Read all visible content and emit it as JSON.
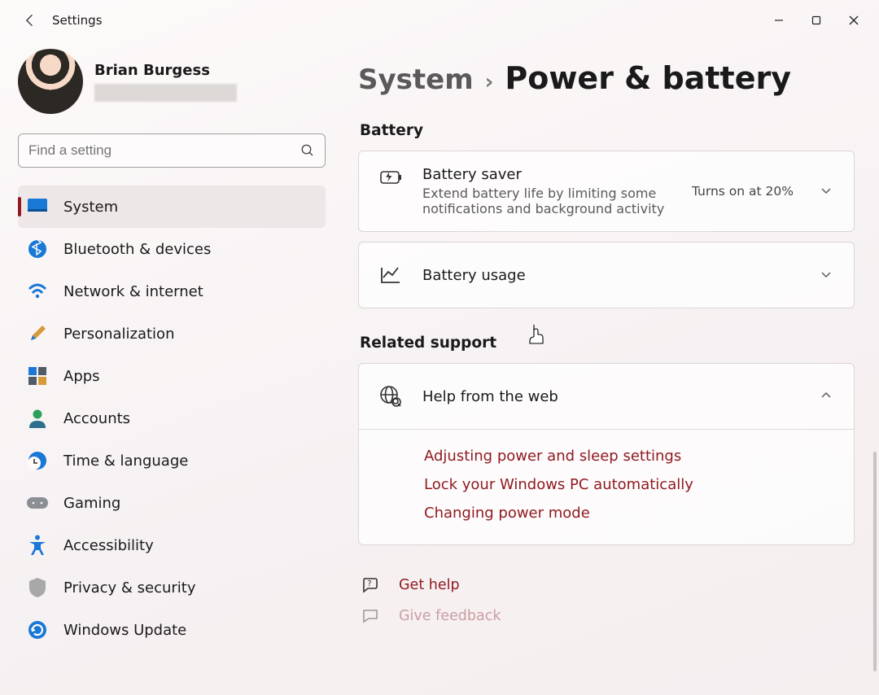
{
  "app": {
    "title": "Settings"
  },
  "user": {
    "name": "Brian Burgess"
  },
  "search": {
    "placeholder": "Find a setting"
  },
  "nav": {
    "items": [
      {
        "label": "System",
        "active": true
      },
      {
        "label": "Bluetooth & devices"
      },
      {
        "label": "Network & internet"
      },
      {
        "label": "Personalization"
      },
      {
        "label": "Apps"
      },
      {
        "label": "Accounts"
      },
      {
        "label": "Time & language"
      },
      {
        "label": "Gaming"
      },
      {
        "label": "Accessibility"
      },
      {
        "label": "Privacy & security"
      },
      {
        "label": "Windows Update"
      }
    ]
  },
  "breadcrumb": {
    "parent": "System",
    "current": "Power & battery"
  },
  "sections": {
    "battery": {
      "heading": "Battery",
      "saver": {
        "title": "Battery saver",
        "sub": "Extend battery life by limiting some notifications and background activity",
        "value": "Turns on at 20%"
      },
      "usage": {
        "title": "Battery usage"
      }
    },
    "related": {
      "heading": "Related support",
      "help_web": {
        "title": "Help from the web"
      },
      "links": [
        "Adjusting power and sleep settings",
        "Lock your Windows PC automatically",
        "Changing power mode"
      ]
    }
  },
  "footer": {
    "get_help": "Get help",
    "feedback": "Give feedback"
  }
}
